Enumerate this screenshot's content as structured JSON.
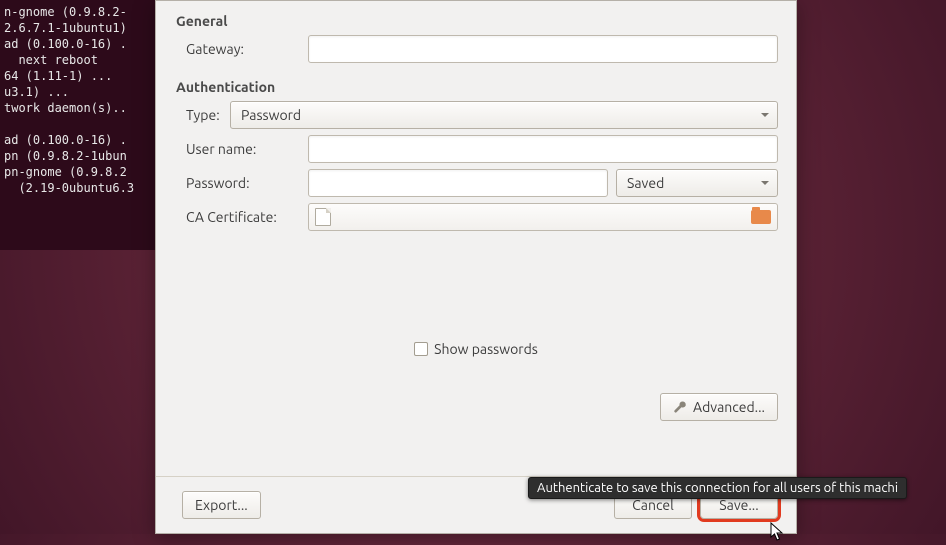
{
  "terminal_text": "n-gnome (0.9.8.2-\n2.6.7.1-1ubuntu1)\nad (0.100.0-16) .\n  next reboot\n64 (1.11-1) ...\nu3.1) ...\ntwork daemon(s)..\n\nad (0.100.0-16) .\npn (0.9.8.2-1ubun\npn-gnome (0.9.8.2\n  (2.19-0ubuntu6.3",
  "sections": {
    "general": {
      "title": "General",
      "gateway_label": "Gateway:",
      "gateway_value": ""
    },
    "auth": {
      "title": "Authentication",
      "type_label": "Type:",
      "type_value": "Password",
      "username_label": "User name:",
      "username_value": "",
      "password_label": "Password:",
      "password_value": "",
      "password_store_value": "Saved",
      "cacert_label": "CA Certificate:",
      "cacert_value": ""
    }
  },
  "show_passwords_label": "Show passwords",
  "advanced_label": "Advanced...",
  "footer": {
    "export_label": "Export...",
    "cancel_label": "Cancel",
    "save_label": "Save..."
  },
  "tooltip_text": "Authenticate to save this connection for all users of this machi",
  "colors": {
    "highlight_ring": "#e13a1f",
    "panel_bg": "#f2f1f0"
  }
}
